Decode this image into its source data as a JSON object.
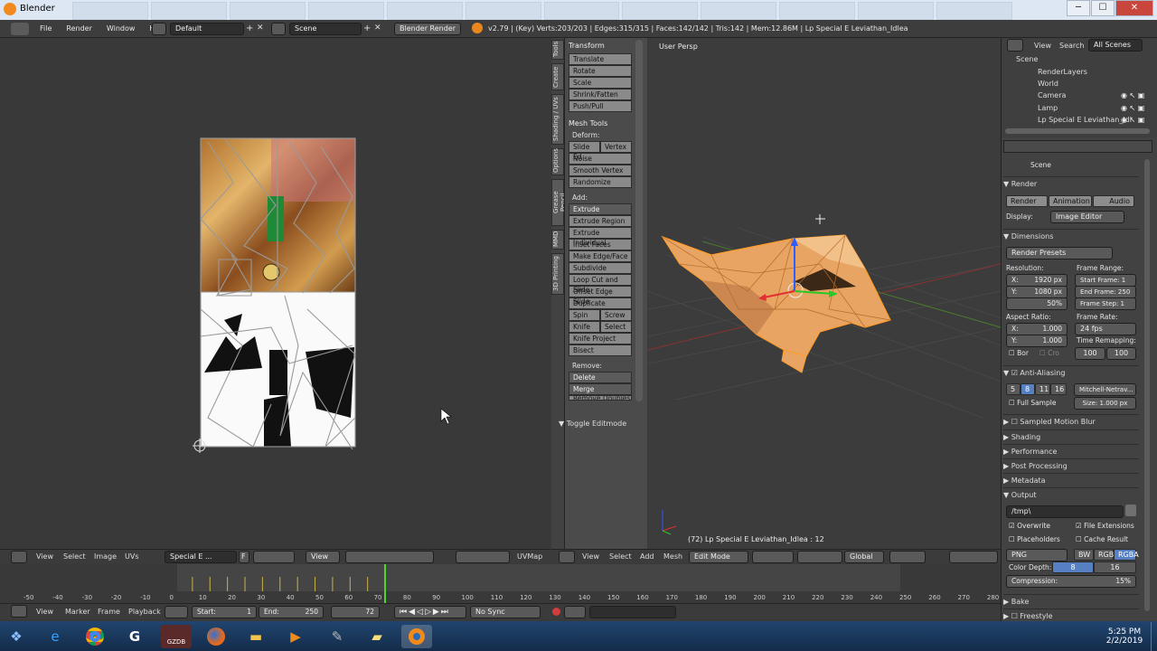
{
  "window": {
    "title": "Blender",
    "min": "─",
    "max": "☐",
    "close": "✕"
  },
  "menubar": {
    "items": [
      "File",
      "Render",
      "Window",
      "Help"
    ],
    "layout": "Default",
    "scene": "Scene",
    "engine": "Blender Render",
    "stats": "v2.79 | (Key) Verts:203/203 | Edges:315/315 | Faces:142/142 | Tris:142 | Mem:12.86M | Lp Special E Leviathan_Idlea"
  },
  "uv_editor": {
    "menu": [
      "View",
      "Select",
      "Image",
      "UVs"
    ],
    "image_name": "Special E ... map.bmp",
    "f_label": "F",
    "view_label": "View",
    "uvmap_label": "UVMap"
  },
  "tool_tabs": [
    "Tools",
    "Create",
    "Shading / UVs",
    "Options",
    "Grease Pencil",
    "MMD",
    "3D Printing"
  ],
  "tools": {
    "transform_header": "Transform",
    "transform": [
      "Translate",
      "Rotate",
      "Scale",
      "Shrink/Fatten",
      "Push/Pull"
    ],
    "mesh_tools_header": "Mesh Tools",
    "deform_label": "Deform:",
    "slide_edge": "Slide Ed",
    "vertex": "Vertex",
    "deform": [
      "Noise",
      "Smooth Vertex",
      "Randomize"
    ],
    "add_label": "Add:",
    "extrude": "Extrude",
    "add": [
      "Extrude Region",
      "Extrude Individual",
      "Inset Faces",
      "Make Edge/Face",
      "Subdivide",
      "Loop Cut and Slide",
      "Offset Edge Slide",
      "Duplicate"
    ],
    "spin": "Spin",
    "screw": "Screw",
    "knife": "Knife",
    "select": "Select",
    "knife_project": "Knife Project",
    "bisect": "Bisect",
    "remove_label": "Remove:",
    "delete": "Delete",
    "merge": "Merge",
    "remove_doubles": "Remove Doubles",
    "toggle_editmode": "Toggle Editmode"
  },
  "viewport": {
    "label": "User Persp",
    "object_info": "(72) Lp Special E Leviathan_Idlea : 12",
    "menu": [
      "View",
      "Select",
      "Add",
      "Mesh"
    ],
    "mode": "Edit Mode",
    "orientation": "Global"
  },
  "outliner": {
    "menu": [
      "View",
      "Search"
    ],
    "filter": "All Scenes",
    "items": [
      "Scene",
      "RenderLayers",
      "World",
      "Camera",
      "Lamp",
      "Lp Special E Leviathan_Idl"
    ]
  },
  "properties": {
    "scene": "Scene",
    "render_header": "Render",
    "render_btn": "Render",
    "animation_btn": "Animation",
    "audio_btn": "Audio",
    "display_label": "Display:",
    "display_value": "Image Editor",
    "dimensions_header": "Dimensions",
    "render_presets": "Render Presets",
    "resolution_label": "Resolution:",
    "res_x": "X:",
    "res_x_val": "1920 px",
    "res_y": "Y:",
    "res_y_val": "1080 px",
    "res_pct": "50%",
    "frame_range_label": "Frame Range:",
    "start_frame": "Start Frame: 1",
    "end_frame": "End Frame: 250",
    "frame_step": "Frame Step: 1",
    "aspect_label": "Aspect Ratio:",
    "asp_x": "X:",
    "asp_x_val": "1.000",
    "asp_y": "Y:",
    "asp_y_val": "1.000",
    "frame_rate_label": "Frame Rate:",
    "frame_rate": "24 fps",
    "time_remap_label": "Time Remapping:",
    "remap_old": "100",
    "remap_new": "100",
    "bor": "Bor",
    "cro": "Cro",
    "aa_header": "Anti-Aliasing",
    "aa_samples": [
      "5",
      "8",
      "11",
      "16"
    ],
    "aa_filter": "Mitchell-Netrav...",
    "full_sample": "Full Sample",
    "aa_size": "Size: 1.000 px",
    "panels": [
      "Sampled Motion Blur",
      "Shading",
      "Performance",
      "Post Processing",
      "Metadata"
    ],
    "output_header": "Output",
    "output_path": "/tmp\\",
    "overwrite": "Overwrite",
    "file_ext": "File Extensions",
    "placeholders": "Placeholders",
    "cache_result": "Cache Result",
    "format": "PNG",
    "bw": "BW",
    "rgb": "RGB",
    "rgba": "RGBA",
    "color_depth_label": "Color Depth:",
    "depth_8": "8",
    "depth_16": "16",
    "compression": "Compression:",
    "compression_val": "15%",
    "bake": "Bake",
    "freestyle": "Freestyle"
  },
  "timeline": {
    "ticks": [
      "-50",
      "-40",
      "-30",
      "-20",
      "-10",
      "0",
      "10",
      "20",
      "30",
      "40",
      "50",
      "60",
      "70",
      "80",
      "90",
      "100",
      "110",
      "120",
      "130",
      "140",
      "150",
      "160",
      "170",
      "180",
      "190",
      "200",
      "210",
      "220",
      "230",
      "240",
      "250",
      "260",
      "270",
      "280"
    ],
    "current_frame": 72,
    "menu": [
      "View",
      "Marker",
      "Frame",
      "Playback"
    ],
    "start": "Start:",
    "start_val": "1",
    "end": "End:",
    "end_val": "250",
    "current": "72",
    "sync": "No Sync"
  },
  "taskbar": {
    "time": "5:25 PM",
    "date": "2/2/2019",
    "gzdb": "GZDB"
  }
}
